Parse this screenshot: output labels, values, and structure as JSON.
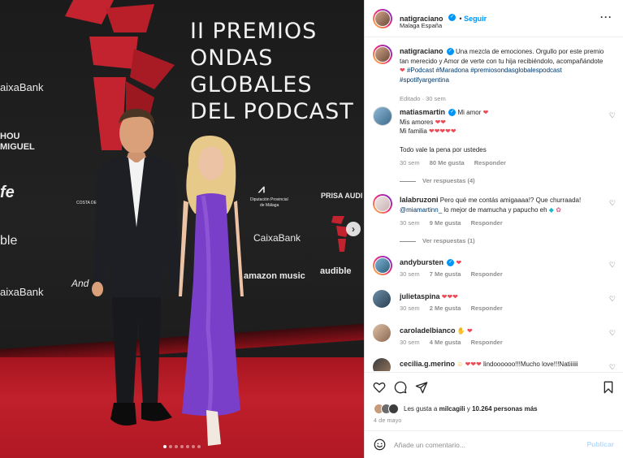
{
  "post_image": {
    "title_lines": [
      "II PREMIOS",
      "ONDAS",
      "GLOBALES",
      "DEL PODCAST"
    ],
    "sponsors_left": [
      "aixaBank",
      "HOU",
      "MIGUEL",
      "fe",
      "ble",
      "aixaBank"
    ],
    "sponsors_center": {
      "costa": "COSTA DE",
      "diputacion": [
        "Diputación Provincial",
        "de Málaga"
      ],
      "prisa": "PRISA AUDI",
      "caixabank": "CaixaBank",
      "amazon": "amazon music",
      "audible": "audible",
      "andalucia": "And"
    },
    "carousel_dots": 7,
    "active_dot": 0,
    "next_arrow": "›"
  },
  "header": {
    "username": "natigraciano",
    "follow_label": "Seguir",
    "location": "Malaga España",
    "more_icon": "more-dots-icon"
  },
  "caption": {
    "username": "natigraciano",
    "text": "Una mezcla de emociones. Orgullo por este premio tan merecido y Amor de verte con tu hija recibiéndolo, acompañándote",
    "hashtags": "#Podcast #Maradona #premiosondasglobalespodcast #spotifyargentina",
    "meta": "Editado · 30 sem"
  },
  "comments": [
    {
      "username": "matiasmartin",
      "lines": [
        "Mi amor",
        "Mis amores",
        "Mi familia",
        "",
        "Todo vale la pena por ustedes"
      ],
      "time": "30 sem",
      "likes": "80 Me gusta",
      "reply": "Responder",
      "view_replies": "Ver respuestas (4)"
    },
    {
      "username": "lalabruzoni",
      "text": "Pero qué me contás amigaaaa!? Que churraada!",
      "mention": "@miamartinn_",
      "text2": "lo mejor de mamucha y papucho eh",
      "time": "30 sem",
      "likes": "9 Me gusta",
      "reply": "Responder",
      "view_replies": "Ver respuestas (1)"
    },
    {
      "username": "andybursten",
      "time": "30 sem",
      "likes": "7 Me gusta",
      "reply": "Responder"
    },
    {
      "username": "julietaspina",
      "time": "30 sem",
      "likes": "2 Me gusta",
      "reply": "Responder"
    },
    {
      "username": "caroladelbianco",
      "time": "30 sem",
      "likes": "4 Me gusta",
      "reply": "Responder"
    },
    {
      "username": "cecilia.g.merino",
      "text": "lindoooooo!!!Mucho love!!!Natiiiiii"
    }
  ],
  "likes_summary": {
    "prefix": "Les gusta a",
    "user": "milcagili",
    "middle": "y",
    "count": "10.264 personas más"
  },
  "date": "4 de mayo",
  "add_comment": {
    "placeholder": "Añade un comentario...",
    "publish_label": "Publicar"
  },
  "colors": {
    "accent": "#0095f6",
    "like_red": "#ed4956",
    "carpet": "#c0202b",
    "dress": "#7a3fc8"
  }
}
